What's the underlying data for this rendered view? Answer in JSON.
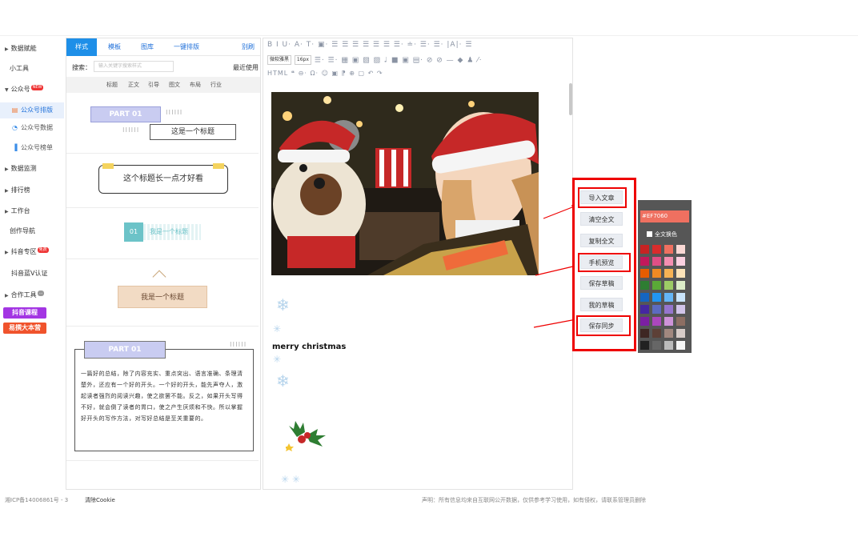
{
  "sidebar": {
    "items": [
      {
        "label": "数据赋能",
        "type": "group"
      },
      {
        "label": "小工具",
        "type": "plain"
      },
      {
        "label": "公众号",
        "type": "group",
        "badge": "NEW"
      },
      {
        "label": "公众号排版",
        "type": "sub",
        "icon": "layout-icon"
      },
      {
        "label": "公众号数据",
        "type": "sub",
        "icon": "clock-icon"
      },
      {
        "label": "公众号榜单",
        "type": "sub",
        "icon": "bar-chart-icon"
      },
      {
        "label": "数据监测",
        "type": "group"
      },
      {
        "label": "排行榜",
        "type": "group"
      },
      {
        "label": "工作台",
        "type": "group"
      },
      {
        "label": "创作导航",
        "type": "plain"
      },
      {
        "label": "抖音专区",
        "type": "group",
        "badge": "免费"
      },
      {
        "label": "抖音蓝V认证",
        "type": "plain"
      },
      {
        "label": "合作工具",
        "type": "group",
        "badge": "..."
      }
    ],
    "promo": [
      {
        "label": "抖音课程",
        "color": "#a335e3"
      },
      {
        "label": "易撰大本营",
        "color": "#f0532c"
      }
    ]
  },
  "library": {
    "tabs": [
      "样式",
      "模板",
      "图库",
      "一键排版",
      "别刷"
    ],
    "search_label": "搜索：",
    "search_placeholder": "输入关键字搜索样式",
    "recent": "最近使用",
    "categories": [
      "标题",
      "正文",
      "引导",
      "图文",
      "布局",
      "行业"
    ],
    "templates": [
      {
        "part": "PART 01",
        "dots": "⁝⁝⁝⁝⁝⁝",
        "dots2": "⁝⁝⁝⁝⁝⁝",
        "title": "这是一个标题"
      },
      {
        "title": "这个标题长一点才好看"
      },
      {
        "num": "01",
        "title": "我是一个标题"
      },
      {
        "title": "我是一个标题"
      },
      {
        "part": "PART 01",
        "dots": "⁝⁝⁝⁝⁝⁝",
        "body": "一篇好的总结，除了内容充实、重点突出、语言准确、条理清楚外，还应有一个好的开头。一个好的开头，能先声夺人，激起读者强烈的阅读兴趣，使之欲罢不能。反之，如果开头写得不好，就会倒了读者的胃口，使之产生厌烦和不快。所以掌握好开头的写作方法，对写好总结是至关重要的。"
      }
    ]
  },
  "editor": {
    "toolbar_row1": "B  I  U· A· T· ▣· ☰ ☰ ☰ ☰ ☰ ☰ ☰· ≐· ☰· ☰· |A|· ☰",
    "font_select": "微软雅黑",
    "size_select": "16px",
    "toolbar_row2": "☰· ☰· ▦ ▣ ▨ ▧ ♩ ■ ▣ ▤· ⊘ ⊘ — ◆ ♟ ⁄·",
    "toolbar_row3": "HTML ❝ ⊖· Ω· ☺ ▣ ⁋ ⊕ ▢ ↶ ↷",
    "photo_alt": "girl and teddy bear reading a christmas book",
    "text": "merry christmas"
  },
  "actions": [
    "导入文章",
    "清空全文",
    "复制全文",
    "手机预览",
    "保存草稿",
    "我的草稿",
    "保存同步"
  ],
  "palette": {
    "hex": "#EF7060",
    "fulltext_label": "全文换色",
    "rows": [
      [
        "#c72323",
        "#d82c2c",
        "#ef7060",
        "#f9d8d4"
      ],
      [
        "#c2185b",
        "#e04f86",
        "#f48fb1",
        "#fbd0e0"
      ],
      [
        "#e65c00",
        "#f08a24",
        "#f7b254",
        "#fde3b8"
      ],
      [
        "#2e7d32",
        "#5aaa37",
        "#9ccc65",
        "#dcedc8"
      ],
      [
        "#1565c0",
        "#2196f3",
        "#64b5f6",
        "#c9e4fb"
      ],
      [
        "#4527a0",
        "#5c6bc0",
        "#9575cd",
        "#d1c4e9"
      ],
      [
        "#7b1fa2",
        "#ab47bc",
        "#ce93d8",
        "#8d6e63"
      ],
      [
        "#3e2723",
        "#5d4037",
        "#a1887f",
        "#d7ccc8"
      ],
      [
        "#222222",
        "#666666",
        "#bbbbbb",
        "#f5f5f5"
      ]
    ]
  },
  "footer": {
    "icp": "湘ICP备14006861号 - 3",
    "clear_cookie": "清除Cookie",
    "disclaimer": "声明：所有信息均来自互联网公开数据，仅供参考学习使用，如有侵权，请联系管理员删除"
  }
}
